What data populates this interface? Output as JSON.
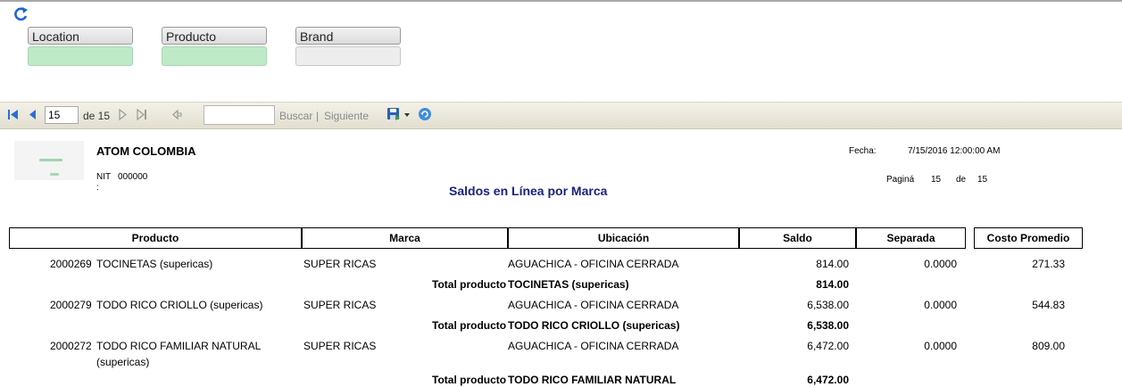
{
  "params": {
    "location_label": "Location",
    "producto_label": "Producto",
    "brand_label": "Brand"
  },
  "toolbar": {
    "page_value": "15",
    "of_pages": "de 15",
    "find_label": "Buscar",
    "separator": "|",
    "next_label": "Siguiente"
  },
  "report": {
    "company": "ATOM COLOMBIA",
    "nit_label": "NIT",
    "nit_value": "000000",
    "colon": ":",
    "title": "Saldos en Línea por Marca",
    "fecha_label": "Fecha:",
    "fecha_value": "7/15/2016 12:00:00 AM",
    "pagina_label": "Paginá",
    "pagina_current": "15",
    "pagina_de": "de",
    "pagina_total": "15"
  },
  "table": {
    "headers": [
      "Producto",
      "Marca",
      "Ubicación",
      "Saldo",
      "Separada",
      "Costo Promedio"
    ],
    "rows": [
      {
        "code": "2000269",
        "name": "TOCINETAS (supericas)",
        "name2": "",
        "marca": "SUPER RICAS",
        "ubicacion": "AGUACHICA  - OFICINA CERRADA",
        "saldo": "814.00",
        "separada": "0.0000",
        "costo": "271.33",
        "total_label": "Total producto",
        "total_name": "TOCINETAS (supericas)",
        "total_saldo": "814.00"
      },
      {
        "code": "2000279",
        "name": "TODO RICO CRIOLLO (supericas)",
        "name2": "",
        "marca": "SUPER RICAS",
        "ubicacion": "AGUACHICA  - OFICINA CERRADA",
        "saldo": "6,538.00",
        "separada": "0.0000",
        "costo": "544.83",
        "total_label": "Total producto",
        "total_name": "TODO RICO CRIOLLO (supericas)",
        "total_saldo": "6,538.00"
      },
      {
        "code": "2000272",
        "name": "TODO RICO FAMILIAR NATURAL",
        "name2": "(supericas)",
        "marca": "SUPER RICAS",
        "ubicacion": "AGUACHICA  - OFICINA CERRADA",
        "saldo": "6,472.00",
        "separada": "0.0000",
        "costo": "809.00",
        "total_label": "Total producto",
        "total_name": "TODO RICO FAMILIAR NATURAL",
        "total_saldo": "6,472.00"
      }
    ]
  },
  "colors": {
    "title": "#1a237e",
    "param_filled": "#bfeac8",
    "toolbar_bg": "#e8e5d8",
    "icon_blue": "#2a6fd6"
  }
}
